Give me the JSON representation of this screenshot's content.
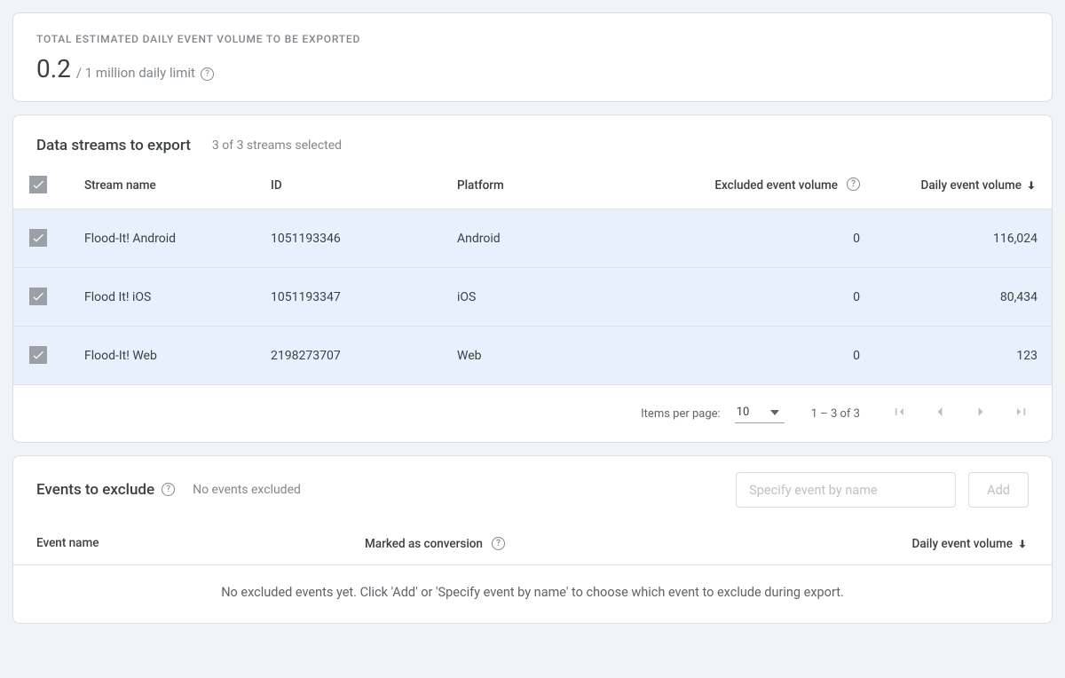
{
  "volume": {
    "label": "TOTAL ESTIMATED DAILY EVENT VOLUME TO BE EXPORTED",
    "value": "0.2",
    "limit": "/ 1 million daily limit"
  },
  "streams": {
    "title": "Data streams to export",
    "subtitle": "3 of 3 streams selected",
    "headers": {
      "name": "Stream name",
      "id": "ID",
      "platform": "Platform",
      "excluded": "Excluded event volume",
      "daily": "Daily event volume"
    },
    "rows": [
      {
        "name": "Flood-It! Android",
        "id": "1051193346",
        "platform": "Android",
        "excluded": "0",
        "daily": "116,024"
      },
      {
        "name": "Flood It! iOS",
        "id": "1051193347",
        "platform": "iOS",
        "excluded": "0",
        "daily": "80,434"
      },
      {
        "name": "Flood-It! Web",
        "id": "2198273707",
        "platform": "Web",
        "excluded": "0",
        "daily": "123"
      }
    ],
    "paginator": {
      "items_per_page_label": "Items per page:",
      "items_per_page_value": "10",
      "range_label": "1 – 3 of 3"
    }
  },
  "events": {
    "title": "Events to exclude",
    "subtitle": "No events excluded",
    "input_placeholder": "Specify event by name",
    "add_label": "Add",
    "headers": {
      "name": "Event name",
      "conversion": "Marked as conversion",
      "daily": "Daily event volume"
    },
    "empty_message": "No excluded events yet. Click 'Add' or 'Specify event by name' to choose which event to exclude during export."
  }
}
